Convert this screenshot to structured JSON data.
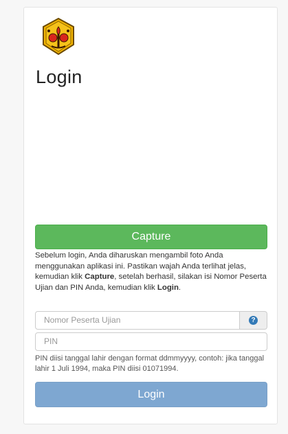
{
  "page": {
    "title": "Login"
  },
  "logo": {
    "icon": "university-crest-icon"
  },
  "capture": {
    "label": "Capture"
  },
  "instructions": {
    "part1": "Sebelum login, Anda diharuskan mengambil foto Anda menggunakan aplikasi ini. Pastikan wajah Anda terlihat jelas, kemudian klik ",
    "capture_word": "Capture",
    "part2": ", setelah berhasil, silakan isi Nomor Peserta Ujian dan PIN Anda, kemudian klik ",
    "login_word": "Login",
    "part3": "."
  },
  "form": {
    "participant_number": {
      "placeholder": "Nomor Peserta Ujian",
      "value": ""
    },
    "pin": {
      "placeholder": "PIN",
      "value": ""
    },
    "pin_help": "PIN diisi tanggal lahir dengan format ddmmyyyy, contoh: jika tanggal lahir 1 Juli 1994, maka PIN diisi 01071994.",
    "help_icon": "?"
  },
  "login": {
    "label": "Login"
  },
  "colors": {
    "capture_button": "#5cb85c",
    "login_button": "#7ea7d1",
    "help_icon": "#337ab7",
    "logo_gold": "#f2b400",
    "logo_red": "#d8261c"
  }
}
